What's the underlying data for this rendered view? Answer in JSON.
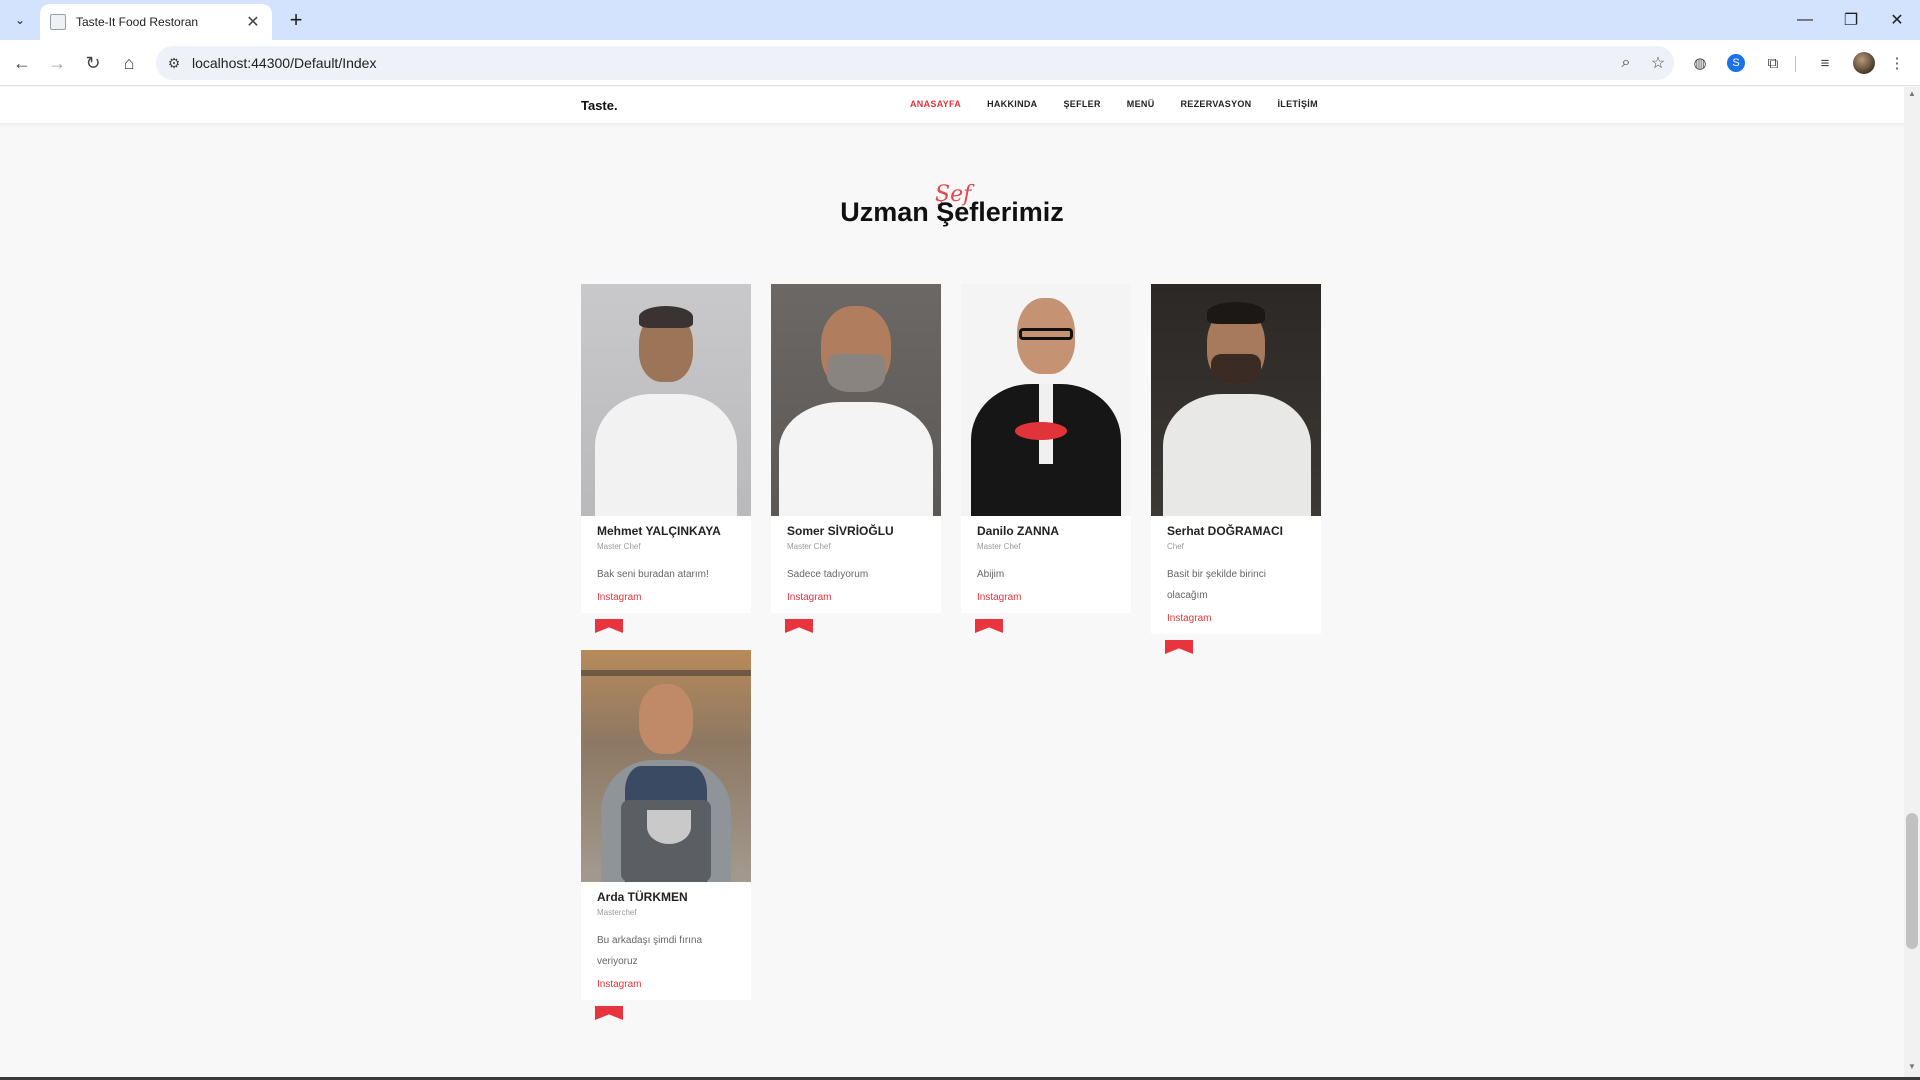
{
  "browser": {
    "tab_title": "Taste-It Food Restoran",
    "url": "localhost:44300/Default/Index",
    "icons": [
      "tab-search-icon",
      "favicon-icon",
      "close-icon",
      "plus-icon",
      "minimize-icon",
      "restore-icon",
      "window-close-icon",
      "back-icon",
      "forward-icon",
      "reload-icon",
      "home-icon",
      "site-info-icon",
      "zoom-icon",
      "star-icon",
      "translate-icon",
      "extension-icon",
      "puzzle-icon",
      "media-icon",
      "profile-avatar",
      "more-icon"
    ]
  },
  "site": {
    "logo": "Taste.",
    "menu": [
      {
        "label": "ANASAYFA",
        "active": true
      },
      {
        "label": "HAKKINDA",
        "active": false
      },
      {
        "label": "ŞEFLER",
        "active": false
      },
      {
        "label": "MENÜ",
        "active": false
      },
      {
        "label": "REZERVASYON",
        "active": false
      },
      {
        "label": "İLETİŞİM",
        "active": false
      }
    ],
    "accent_color": "#e8343d"
  },
  "section": {
    "subheading": "Şef",
    "title": "Uzman Şeflerimiz"
  },
  "chefs": [
    {
      "name": "Mehmet YALÇINKAYA",
      "position": "Master Chef",
      "quote": "Bak seni buradan atarım!",
      "link": "Instagram"
    },
    {
      "name": "Somer SİVRİOĞLU",
      "position": "Master Chef",
      "quote": "Sadece tadıyorum",
      "link": "Instagram"
    },
    {
      "name": "Danilo ZANNA",
      "position": "Master Chef",
      "quote": "Abijim",
      "link": "Instagram"
    },
    {
      "name": "Serhat DOĞRAMACI",
      "position": "Chef",
      "quote": "Basit bir şekilde birinci olacağım",
      "link": "Instagram"
    },
    {
      "name": "Arda TÜRKMEN",
      "position": "Masterchef",
      "quote": "Bu arkadaşı şimdi fırına veriyoruz",
      "link": "Instagram"
    }
  ]
}
